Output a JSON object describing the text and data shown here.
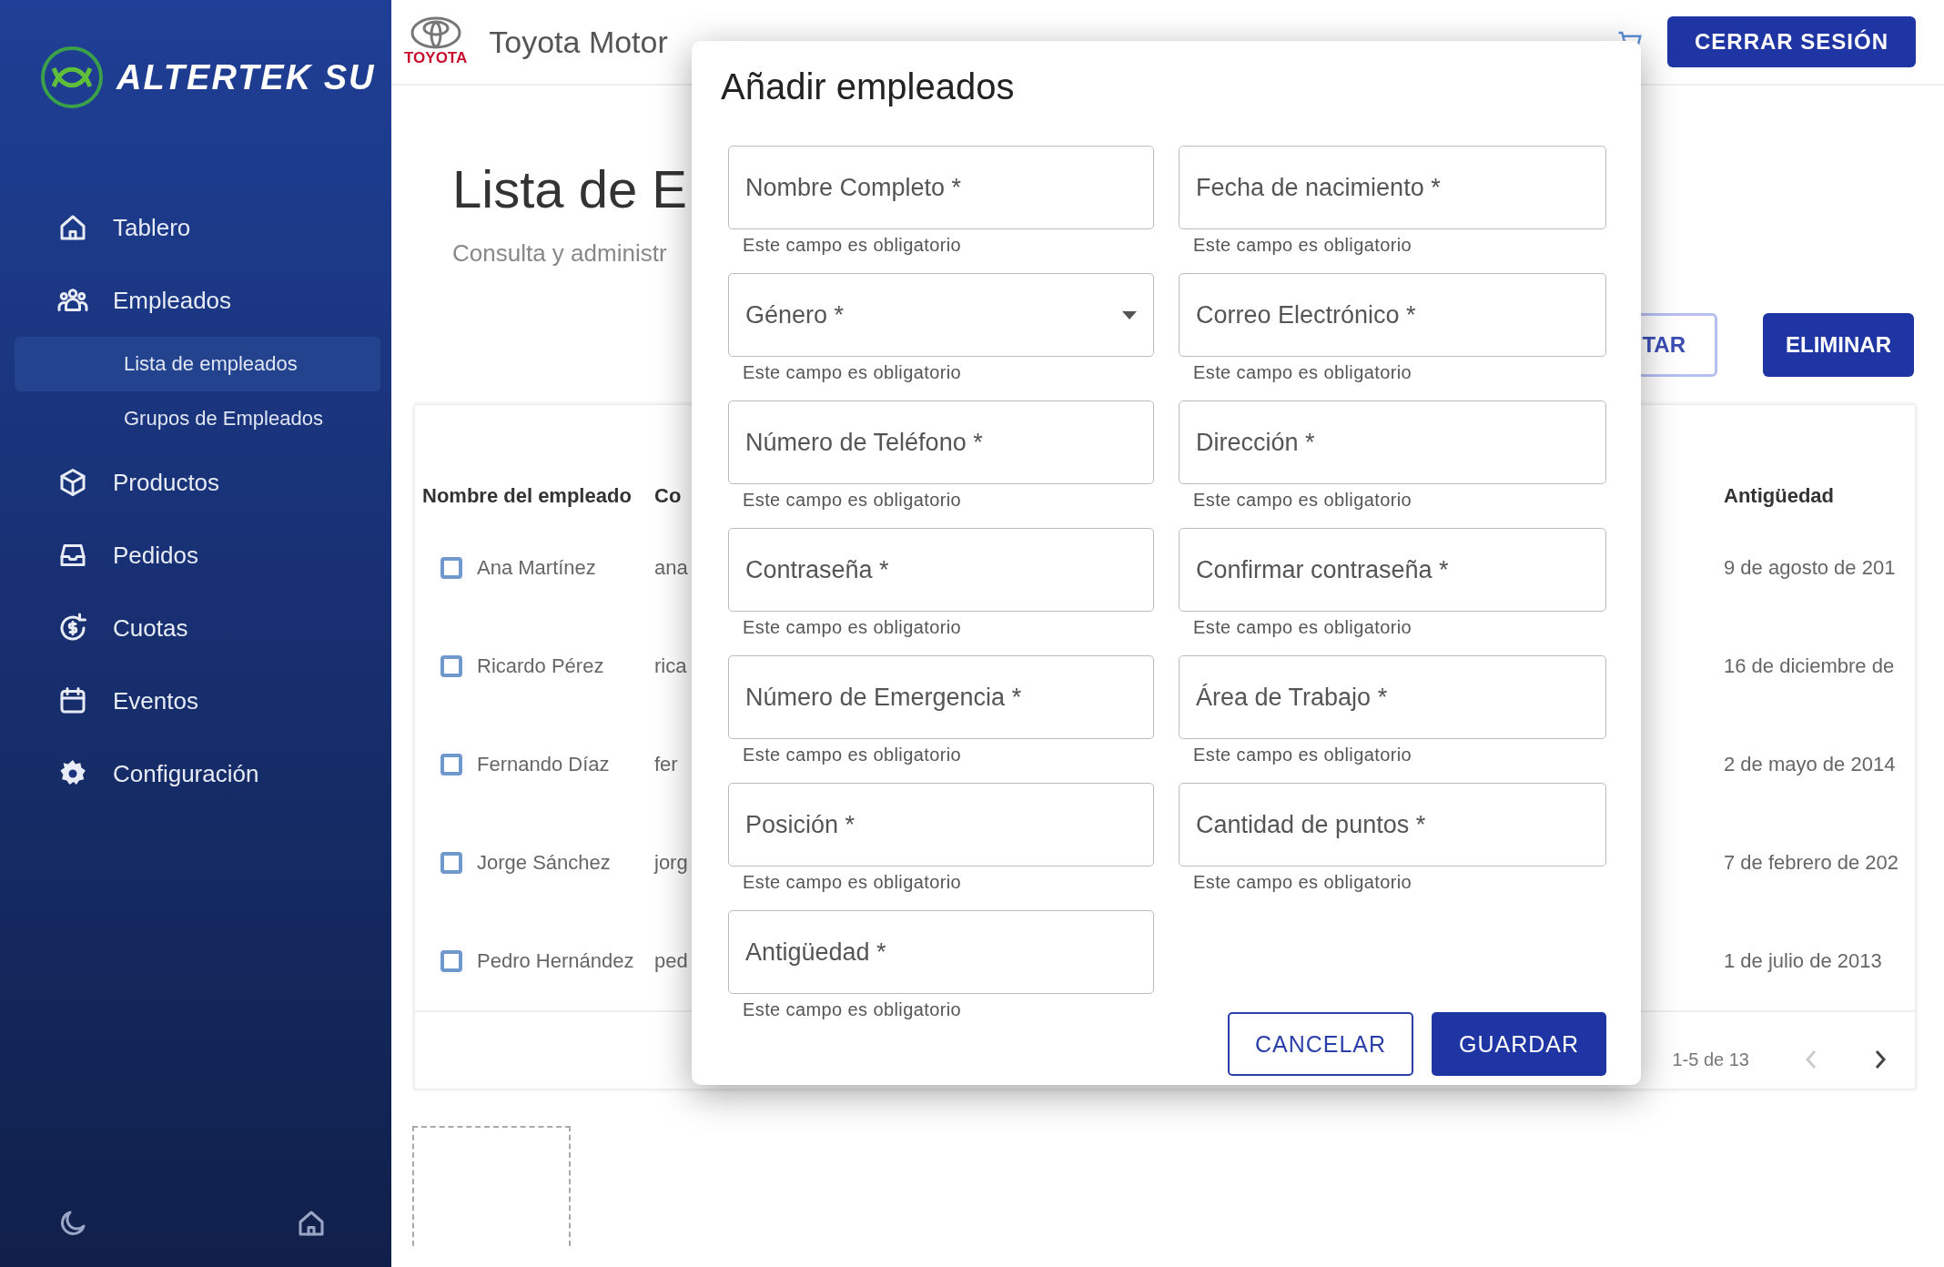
{
  "sidebar": {
    "brand": "ALTERTEK SU",
    "items": [
      {
        "label": "Tablero"
      },
      {
        "label": "Empleados",
        "children": [
          {
            "label": "Lista de empleados",
            "selected": true
          },
          {
            "label": "Grupos de Empleados",
            "selected": false
          }
        ]
      },
      {
        "label": "Productos"
      },
      {
        "label": "Pedidos"
      },
      {
        "label": "Cuotas"
      },
      {
        "label": "Eventos"
      },
      {
        "label": "Configuración"
      }
    ]
  },
  "header": {
    "logo_text": "TOYOTA",
    "company": "Toyota Motor",
    "logout": "CERRAR SESIÓN"
  },
  "page": {
    "title": "Lista de E",
    "subtitle": "Consulta y administr",
    "actions": [
      "TAR",
      "ELIMINAR"
    ]
  },
  "table": {
    "columns": [
      "Nombre del empleado",
      "Co",
      "Antigüedad"
    ],
    "rows": [
      {
        "checked": false,
        "name": "Ana Martínez",
        "column_2": "ana",
        "seniority": "9 de agosto de 201"
      },
      {
        "checked": false,
        "name": "Ricardo Pérez",
        "column_2": "rica",
        "seniority": "16 de diciembre de"
      },
      {
        "checked": false,
        "name": "Fernando Díaz",
        "column_2": "fer",
        "seniority": "2 de mayo de 2014"
      },
      {
        "checked": false,
        "name": "Jorge Sánchez",
        "column_2": "jorg",
        "seniority": "7 de febrero de 202"
      },
      {
        "checked": false,
        "name": "Pedro Hernández",
        "column_2": "ped",
        "seniority": "1 de julio de 2013"
      }
    ],
    "pagination": "1-5 de 13"
  },
  "dialog": {
    "title": "Añadir empleados",
    "fields": [
      {
        "kind": "text",
        "label": "Nombre Completo *",
        "helper": "Este campo es obligatorio"
      },
      {
        "kind": "text",
        "label": "Fecha de nacimiento *",
        "helper": "Este campo es obligatorio"
      },
      {
        "kind": "select",
        "label": "Género *",
        "helper": "Este campo es obligatorio"
      },
      {
        "kind": "text",
        "label": "Correo Electrónico *",
        "helper": "Este campo es obligatorio"
      },
      {
        "kind": "text",
        "label": "Número de Teléfono *",
        "helper": "Este campo es obligatorio"
      },
      {
        "kind": "text",
        "label": "Dirección *",
        "helper": "Este campo es obligatorio"
      },
      {
        "kind": "text",
        "label": "Contraseña *",
        "helper": "Este campo es obligatorio"
      },
      {
        "kind": "text",
        "label": "Confirmar contraseña *",
        "helper": "Este campo es obligatorio"
      },
      {
        "kind": "text",
        "label": "Número de Emergencia *",
        "helper": "Este campo es obligatorio"
      },
      {
        "kind": "text",
        "label": "Área de Trabajo *",
        "helper": "Este campo es obligatorio"
      },
      {
        "kind": "text",
        "label": "Posición *",
        "helper": "Este campo es obligatorio"
      },
      {
        "kind": "text",
        "label": "Cantidad de puntos *",
        "helper": "Este campo es obligatorio"
      },
      {
        "kind": "text",
        "label": "Antigüedad *",
        "helper": "Este campo es obligatorio"
      }
    ],
    "buttons": [
      {
        "kind": "outlined",
        "label": "CANCELAR"
      },
      {
        "kind": "filled",
        "label": "GUARDAR"
      }
    ]
  }
}
